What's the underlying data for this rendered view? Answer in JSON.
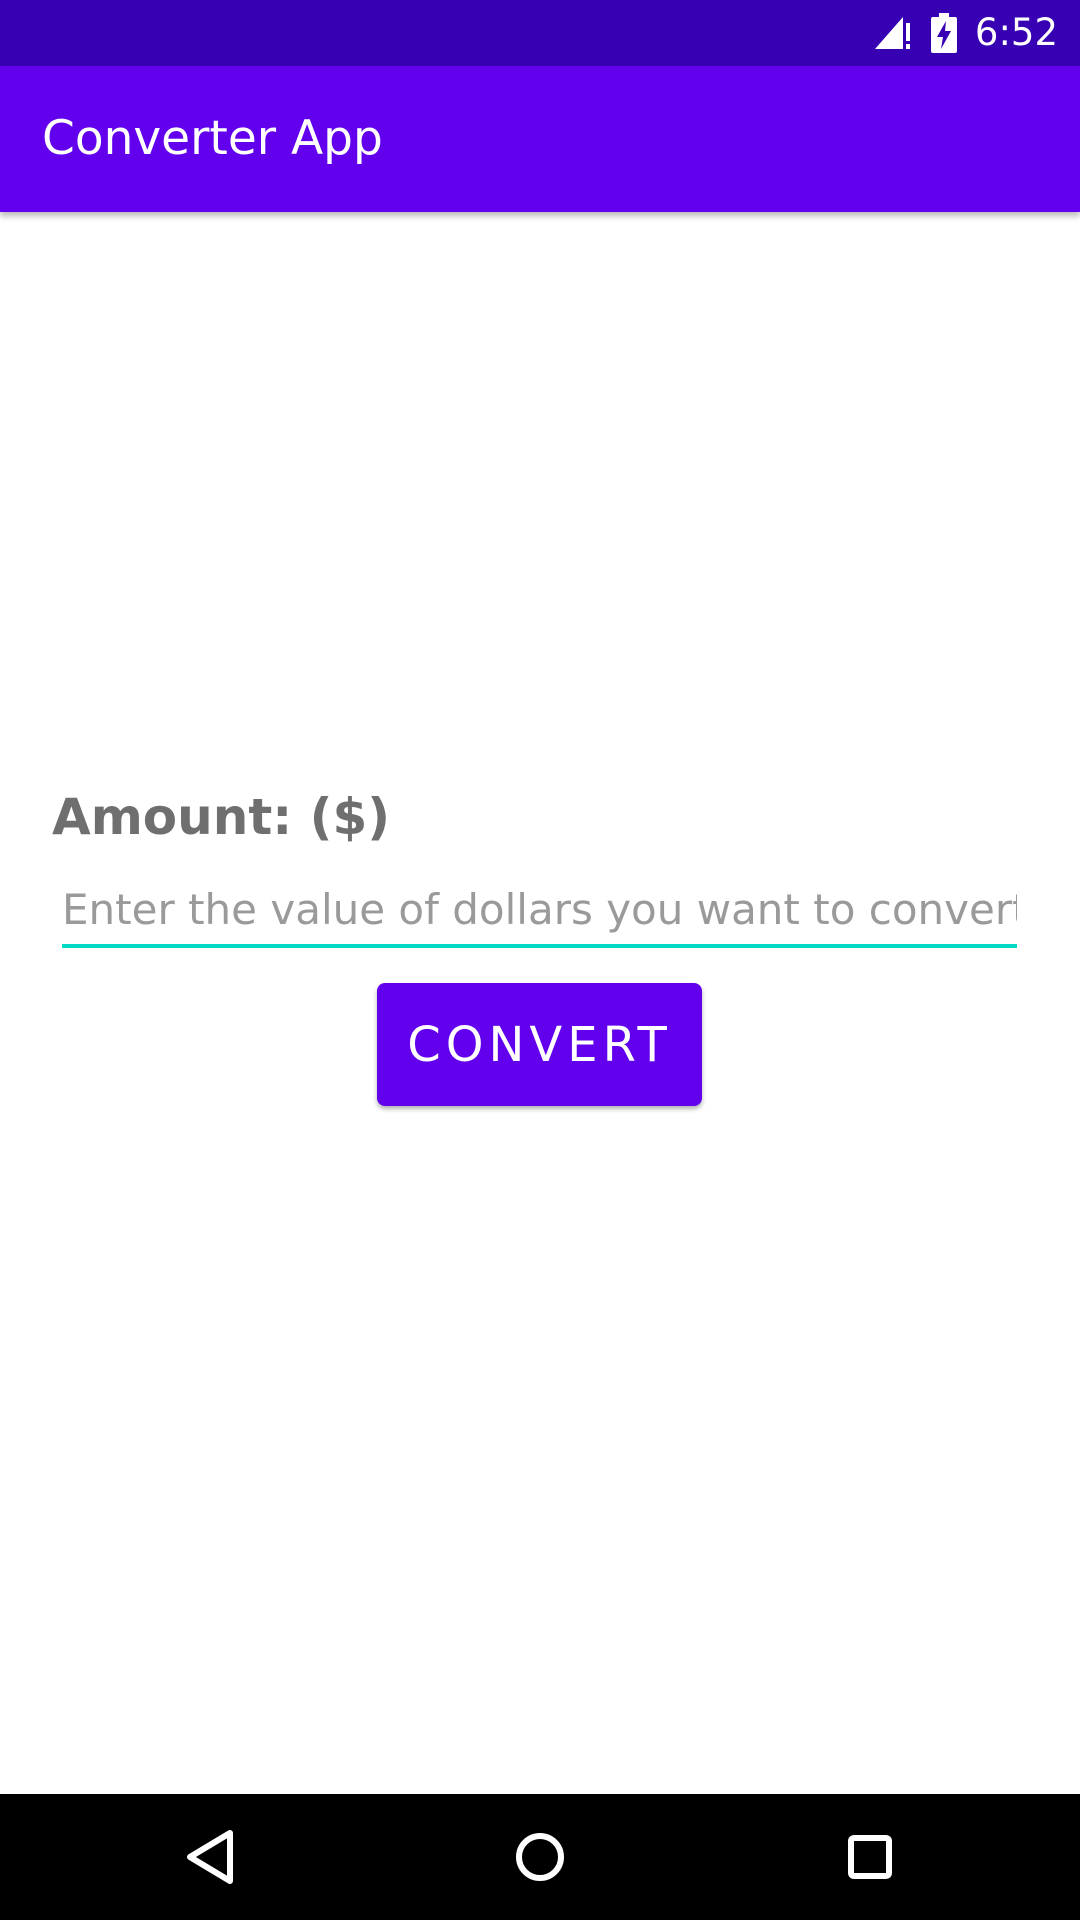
{
  "status_bar": {
    "time": "6:52",
    "icons": [
      "signal-no-data-icon",
      "battery-charging-icon"
    ]
  },
  "app_bar": {
    "title": "Converter App"
  },
  "form": {
    "amount_label": "Amount: ($)",
    "amount_input": {
      "value": "",
      "placeholder": "Enter the value of dollars you want to convert"
    },
    "convert_button_label": "CONVERT"
  },
  "nav_bar": {
    "buttons": [
      "back-icon",
      "home-icon",
      "recents-icon"
    ]
  },
  "colors": {
    "status_bar": "#3700b3",
    "primary": "#6200ee",
    "accent": "#03dac5",
    "label_text": "#6f6f6f",
    "placeholder_text": "#9a9a9a"
  }
}
